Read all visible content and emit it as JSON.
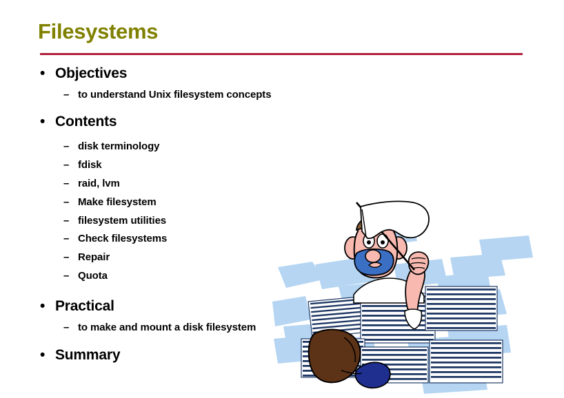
{
  "slide": {
    "title": "Filesystems",
    "title_color": "#808000",
    "rule_color": "#b01f38",
    "background_color": "#ffffff",
    "text_color": "#000000",
    "bullet_marker": "•",
    "dash_marker": "–"
  },
  "sections": [
    {
      "heading": "Objectives",
      "items": [
        "to understand Unix filesystem concepts"
      ]
    },
    {
      "heading": "Contents",
      "items": [
        "disk terminology",
        "fdisk",
        "raid, lvm",
        "Make filesystem",
        "filesystem utilities",
        "Check filesystems",
        "Repair",
        "Quota"
      ]
    },
    {
      "heading": "Practical",
      "items": [
        "to make and mount a disk filesystem"
      ]
    },
    {
      "heading": "Summary",
      "items": []
    }
  ],
  "clipart": {
    "name": "man-surrendering-in-paperwork",
    "description": "Cartoon man buried in stacks of paper waving a white surrender flag",
    "colors": {
      "paper_blue": "#b5d5f2",
      "paper_white": "#ffffff",
      "line_navy": "#1f3864",
      "skin": "#f7b9b0",
      "beard_blue": "#3b6fc4",
      "cap_brown": "#8a6038",
      "shoe_brown": "#5c3317",
      "sock_blue": "#1f2f8f",
      "outline": "#000000"
    }
  }
}
